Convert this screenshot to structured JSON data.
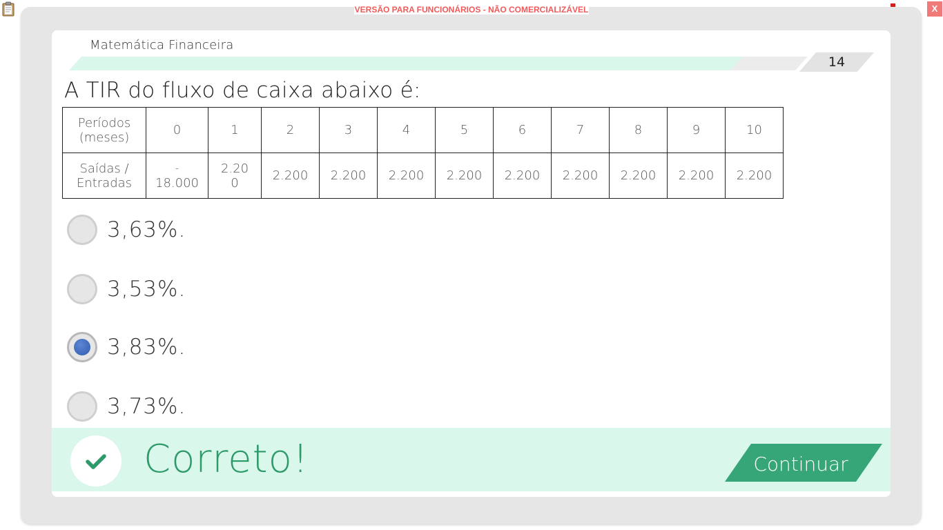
{
  "app": {
    "watermark": "VERSÃO PARA FUNCIONÁRIOS - NÃO COMERCIALIZÁVEL",
    "close_label": "X",
    "accent_color": "#2e9a6a",
    "progress_fill_color": "#d9f7ea",
    "selected_radio_color": "#3a66b8"
  },
  "header": {
    "subject": "Matemática Financeira",
    "page_number": "14",
    "progress_fraction": 0.91
  },
  "question": {
    "text": "A TIR do fluxo de caixa abaixo é:",
    "table": {
      "row1_header_line1": "Períodos",
      "row1_header_line2": "(meses)",
      "row2_header_line1": "Saídas /",
      "row2_header_line2": "Entradas",
      "periods": [
        "0",
        "1",
        "2",
        "3",
        "4",
        "5",
        "6",
        "7",
        "8",
        "9",
        "10"
      ],
      "cash_0_line1": "-",
      "cash_0_line2": "18.000",
      "cash_1_line1": "2.20",
      "cash_1_line2": "0",
      "cash_rest": [
        "2.200",
        "2.200",
        "2.200",
        "2.200",
        "2.200",
        "2.200",
        "2.200",
        "2.200",
        "2.200"
      ]
    }
  },
  "options": [
    {
      "label": "3,63%.",
      "selected": false
    },
    {
      "label": "3,53%.",
      "selected": false
    },
    {
      "label": "3,83%.",
      "selected": true
    },
    {
      "label": "3,73%.",
      "selected": false
    }
  ],
  "feedback": {
    "result_text": "Correto!",
    "continue_label": "Continuar"
  },
  "icons": {
    "top_left": "clipboard-icon",
    "top_right": "network-icon",
    "feedback": "checkmark-icon"
  }
}
